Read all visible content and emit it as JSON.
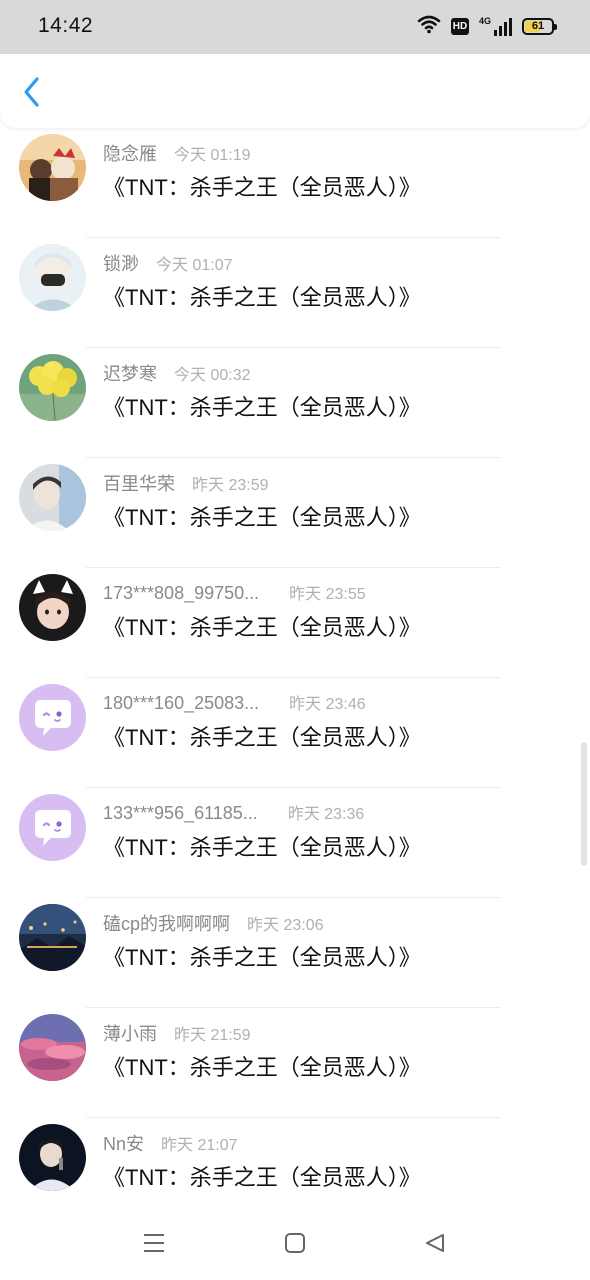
{
  "status_bar": {
    "time": "14:42",
    "network_type": "4G",
    "hd_label": "HD",
    "battery_percent": 61,
    "battery_text": "61",
    "battery_color": "#f2d24a"
  },
  "nav": {
    "back_icon": "chevron-left-icon",
    "accent_color": "#2a9af3"
  },
  "comments": [
    {
      "name": "隐念雁",
      "time": "今天 01:19",
      "message": "《TNT：杀手之王（全员恶人）》",
      "avatar": "photo-two-people"
    },
    {
      "name": "锁渺",
      "time": "今天 01:07",
      "message": "《TNT：杀手之王（全员恶人）》",
      "avatar": "photo-masked-boy"
    },
    {
      "name": "迟梦寒",
      "time": "今天 00:32",
      "message": "《TNT：杀手之王（全员恶人）》",
      "avatar": "photo-yellow-balloons"
    },
    {
      "name": "百里华荣",
      "time": "昨天 23:59",
      "message": "《TNT：杀手之王（全员恶人）》",
      "avatar": "photo-boy-portrait"
    },
    {
      "name": "173***808_99750...",
      "time": "昨天 23:55",
      "message": "《TNT：杀手之王（全员恶人）》",
      "avatar": "photo-girl-cat-ears"
    },
    {
      "name": "180***160_25083...",
      "time": "昨天 23:46",
      "message": "《TNT：杀手之王（全员恶人）》",
      "avatar": "default-chat-bubble"
    },
    {
      "name": "133***956_61185...",
      "time": "昨天 23:36",
      "message": "《TNT：杀手之王（全员恶人）》",
      "avatar": "default-chat-bubble"
    },
    {
      "name": "磕cp的我啊啊啊",
      "time": "昨天 23:06",
      "message": "《TNT：杀手之王（全员恶人）》",
      "avatar": "photo-night-street"
    },
    {
      "name": "薄小雨",
      "time": "昨天 21:59",
      "message": "《TNT：杀手之王（全员恶人）》",
      "avatar": "photo-pink-clouds"
    },
    {
      "name": "Nn安",
      "time": "昨天 21:07",
      "message": "《TNT：杀手之王（全员恶人）》",
      "avatar": "photo-singer-dark"
    }
  ],
  "system_nav": {
    "menu_icon": "menu-lines-icon",
    "home_icon": "square-home-icon",
    "back_icon": "triangle-back-icon"
  }
}
